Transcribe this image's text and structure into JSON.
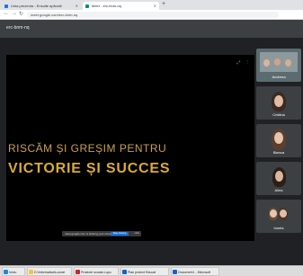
{
  "browser": {
    "tabs": [
      {
        "label": "Lista prezenta - Ensuite aplicatii",
        "fav_color": "#1a73e8"
      },
      {
        "label": "Meet - erc-bnm-nq",
        "fav_color": "#00897b"
      }
    ],
    "url": "meet.google.com/erc-bnm-nq"
  },
  "meet": {
    "code": "erc-bnm-nq"
  },
  "slide": {
    "line1": "RISCĂM ȘI GREȘIM PENTRU",
    "line2": "VICTORIE ȘI SUCCES"
  },
  "share_bar": {
    "message": "meet.google.com is sharing your screen",
    "stop_label": "Stop sharing",
    "hide_label": "Hide"
  },
  "participants": [
    {
      "name": "Andreea"
    },
    {
      "name": "Cristina"
    },
    {
      "name": "Bianca"
    },
    {
      "name": "Alina"
    },
    {
      "name": "Ionela"
    }
  ],
  "windows_taskbar": [
    {
      "label": "Iniciu",
      "icon_color": "#1e88e5"
    },
    {
      "label": "D:\\Informatica\\Lucrari",
      "icon_color": "#f4c542"
    },
    {
      "label": "Proiecte scoala Lupu",
      "icon_color": "#c62828"
    },
    {
      "label": "Plan proiect Educat",
      "icon_color": "#1565c0"
    },
    {
      "label": "Document1 - Microsoft",
      "icon_color": "#1565c0"
    }
  ]
}
